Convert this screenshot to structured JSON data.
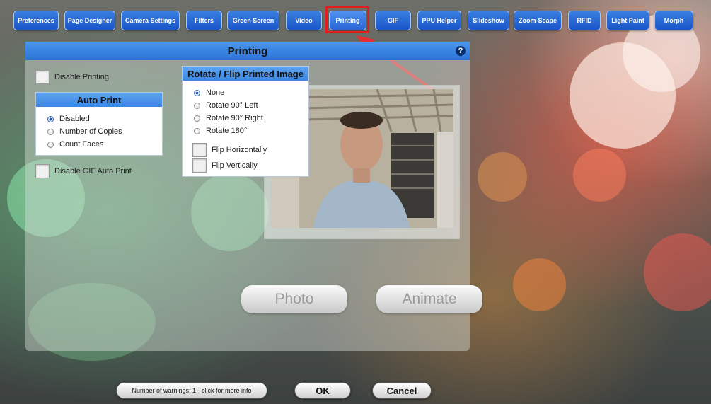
{
  "tabs": [
    "Preferences",
    "Page Designer",
    "Camera Settings",
    "Filters",
    "Green Screen",
    "Video",
    "Printing",
    "GIF",
    "PPU Helper",
    "Slideshow",
    "Zoom-Scape",
    "RFID",
    "Light Paint",
    "Morph"
  ],
  "active_tab": "Printing",
  "dialog": {
    "title": "Printing",
    "help_symbol": "?",
    "disable_printing_label": "Disable Printing",
    "disable_gif_auto_print_label": "Disable GIF Auto Print",
    "auto_print": {
      "title": "Auto Print",
      "options": [
        "Disabled",
        "Number of Copies",
        "Count Faces"
      ],
      "selected": "Disabled"
    },
    "rotate_flip": {
      "title": "Rotate / Flip Printed Image",
      "options": [
        "None",
        "Rotate 90° Left",
        "Rotate 90° Right",
        "Rotate 180°"
      ],
      "selected": "None",
      "flip_horizontal_label": "Flip Horizontally",
      "flip_vertical_label": "Flip Vertically"
    },
    "photo_button": "Photo",
    "animate_button": "Animate"
  },
  "footer": {
    "warnings_button": "Number of warnings: 1 - click for more info",
    "ok_button": "OK",
    "cancel_button": "Cancel"
  },
  "colors": {
    "accent": "#2b74d8",
    "highlight": "#e02020"
  }
}
